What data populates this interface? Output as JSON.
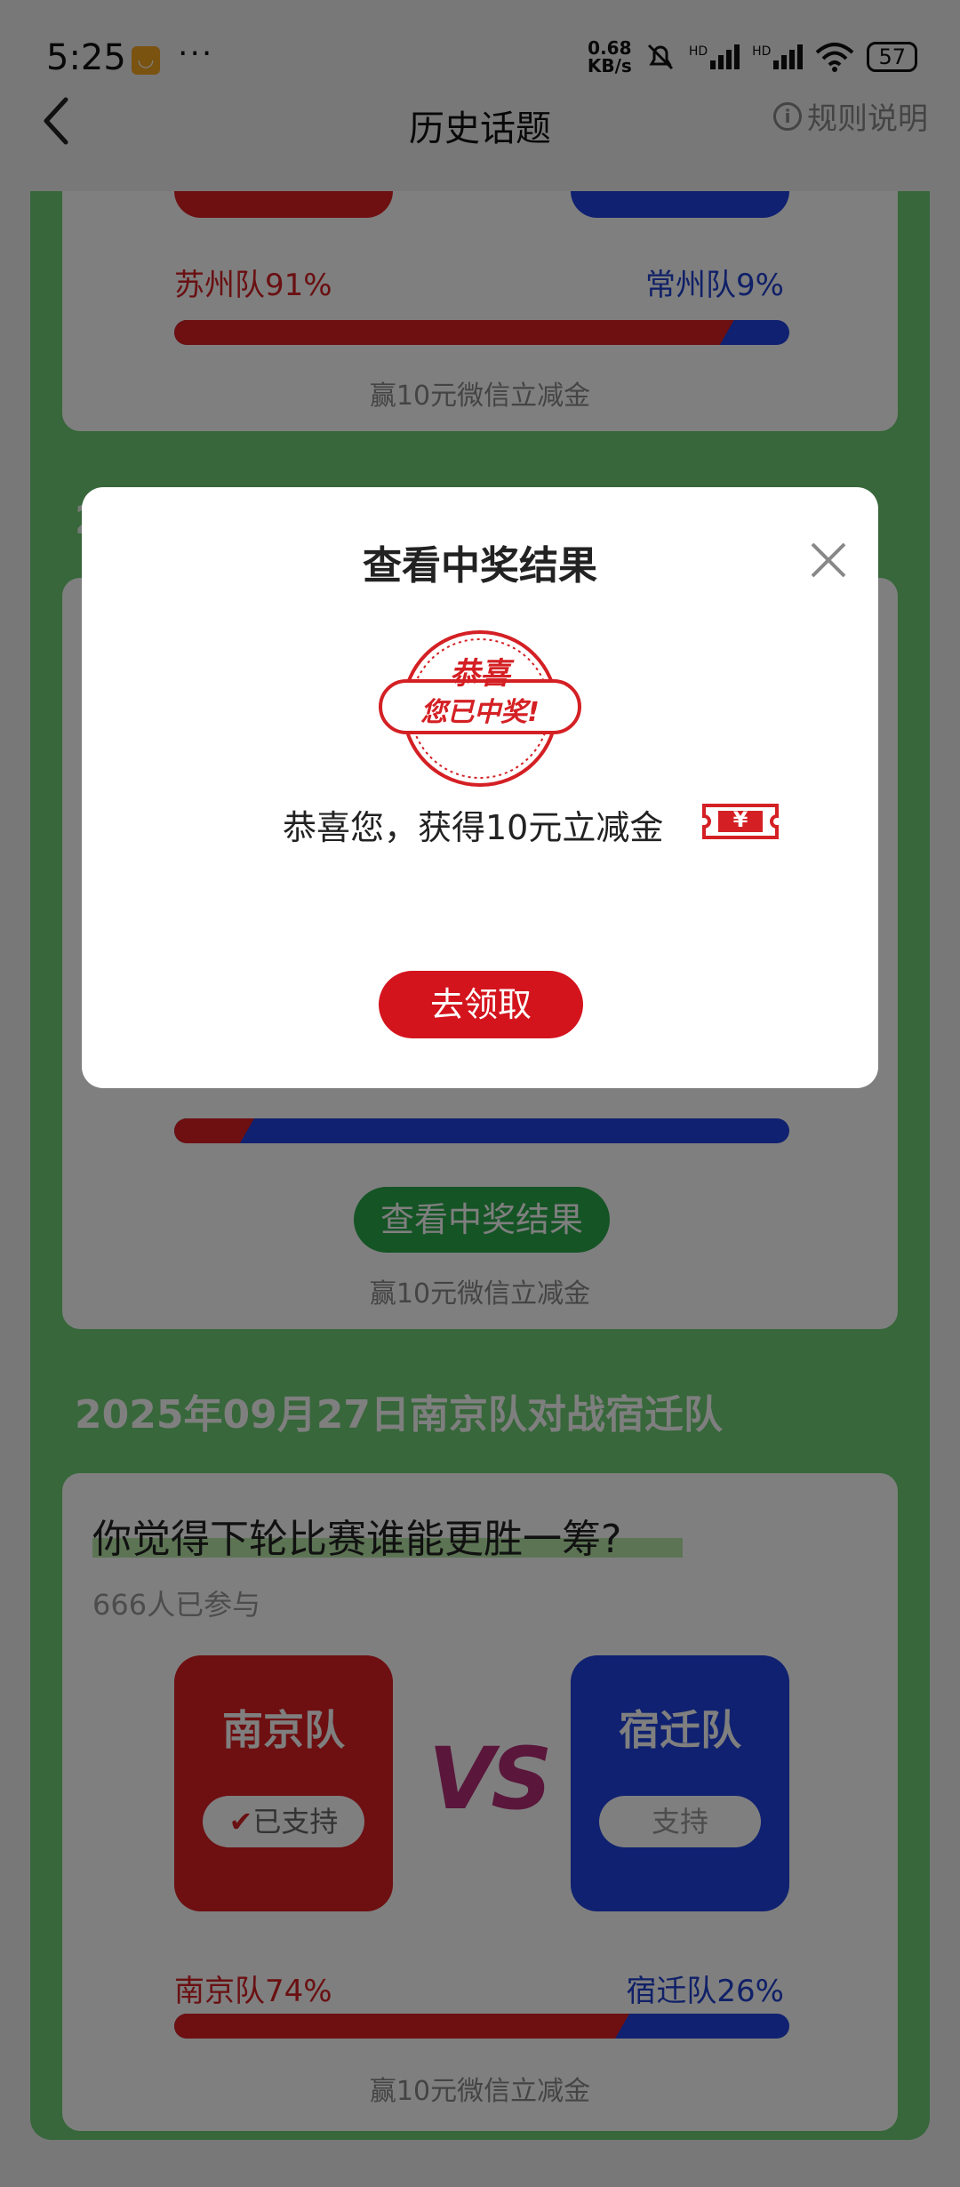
{
  "status_bar": {
    "time": "5:25",
    "more_dots": "···",
    "speed_value": "0.68",
    "speed_unit": "KB/s",
    "signal_label": "HD",
    "battery": "57"
  },
  "header": {
    "title": "历史话题",
    "rules_label": "规则说明"
  },
  "topics": [
    {
      "left_team": "苏州队",
      "right_team": "常州队",
      "left_pct_label": "苏州队91%",
      "right_pct_label": "常州队9%",
      "left_fraction": 0.91,
      "prize_note": "赢10元微信立减金"
    },
    {
      "heading_fragment": "2",
      "result_button": "查看中奖结果",
      "left_fraction": 0.13,
      "prize_note": "赢10元微信立减金"
    },
    {
      "heading": "2025年09月27日南京队对战宿迁队",
      "question": "你觉得下轮比赛谁能更胜一筹?",
      "participants": "666人已参与",
      "left_team": "南京队",
      "right_team": "宿迁队",
      "left_support": "已支持",
      "right_support": "支持",
      "vs": "VS",
      "left_pct_label": "南京队74%",
      "right_pct_label": "宿迁队26%",
      "left_fraction": 0.74,
      "prize_note": "赢10元微信立减金"
    }
  ],
  "modal": {
    "title": "查看中奖结果",
    "stamp_top": "恭喜",
    "stamp_bottom": "您已中奖!",
    "message": "恭喜您，获得10元立减金",
    "coupon_symbol": "¥",
    "claim_button": "去领取"
  },
  "colors": {
    "red_team": "#dd1f22",
    "blue_team": "#1f42e0",
    "green_panel": "#6fce74",
    "claim_red": "#d4141d",
    "result_green": "#2aa84a"
  }
}
